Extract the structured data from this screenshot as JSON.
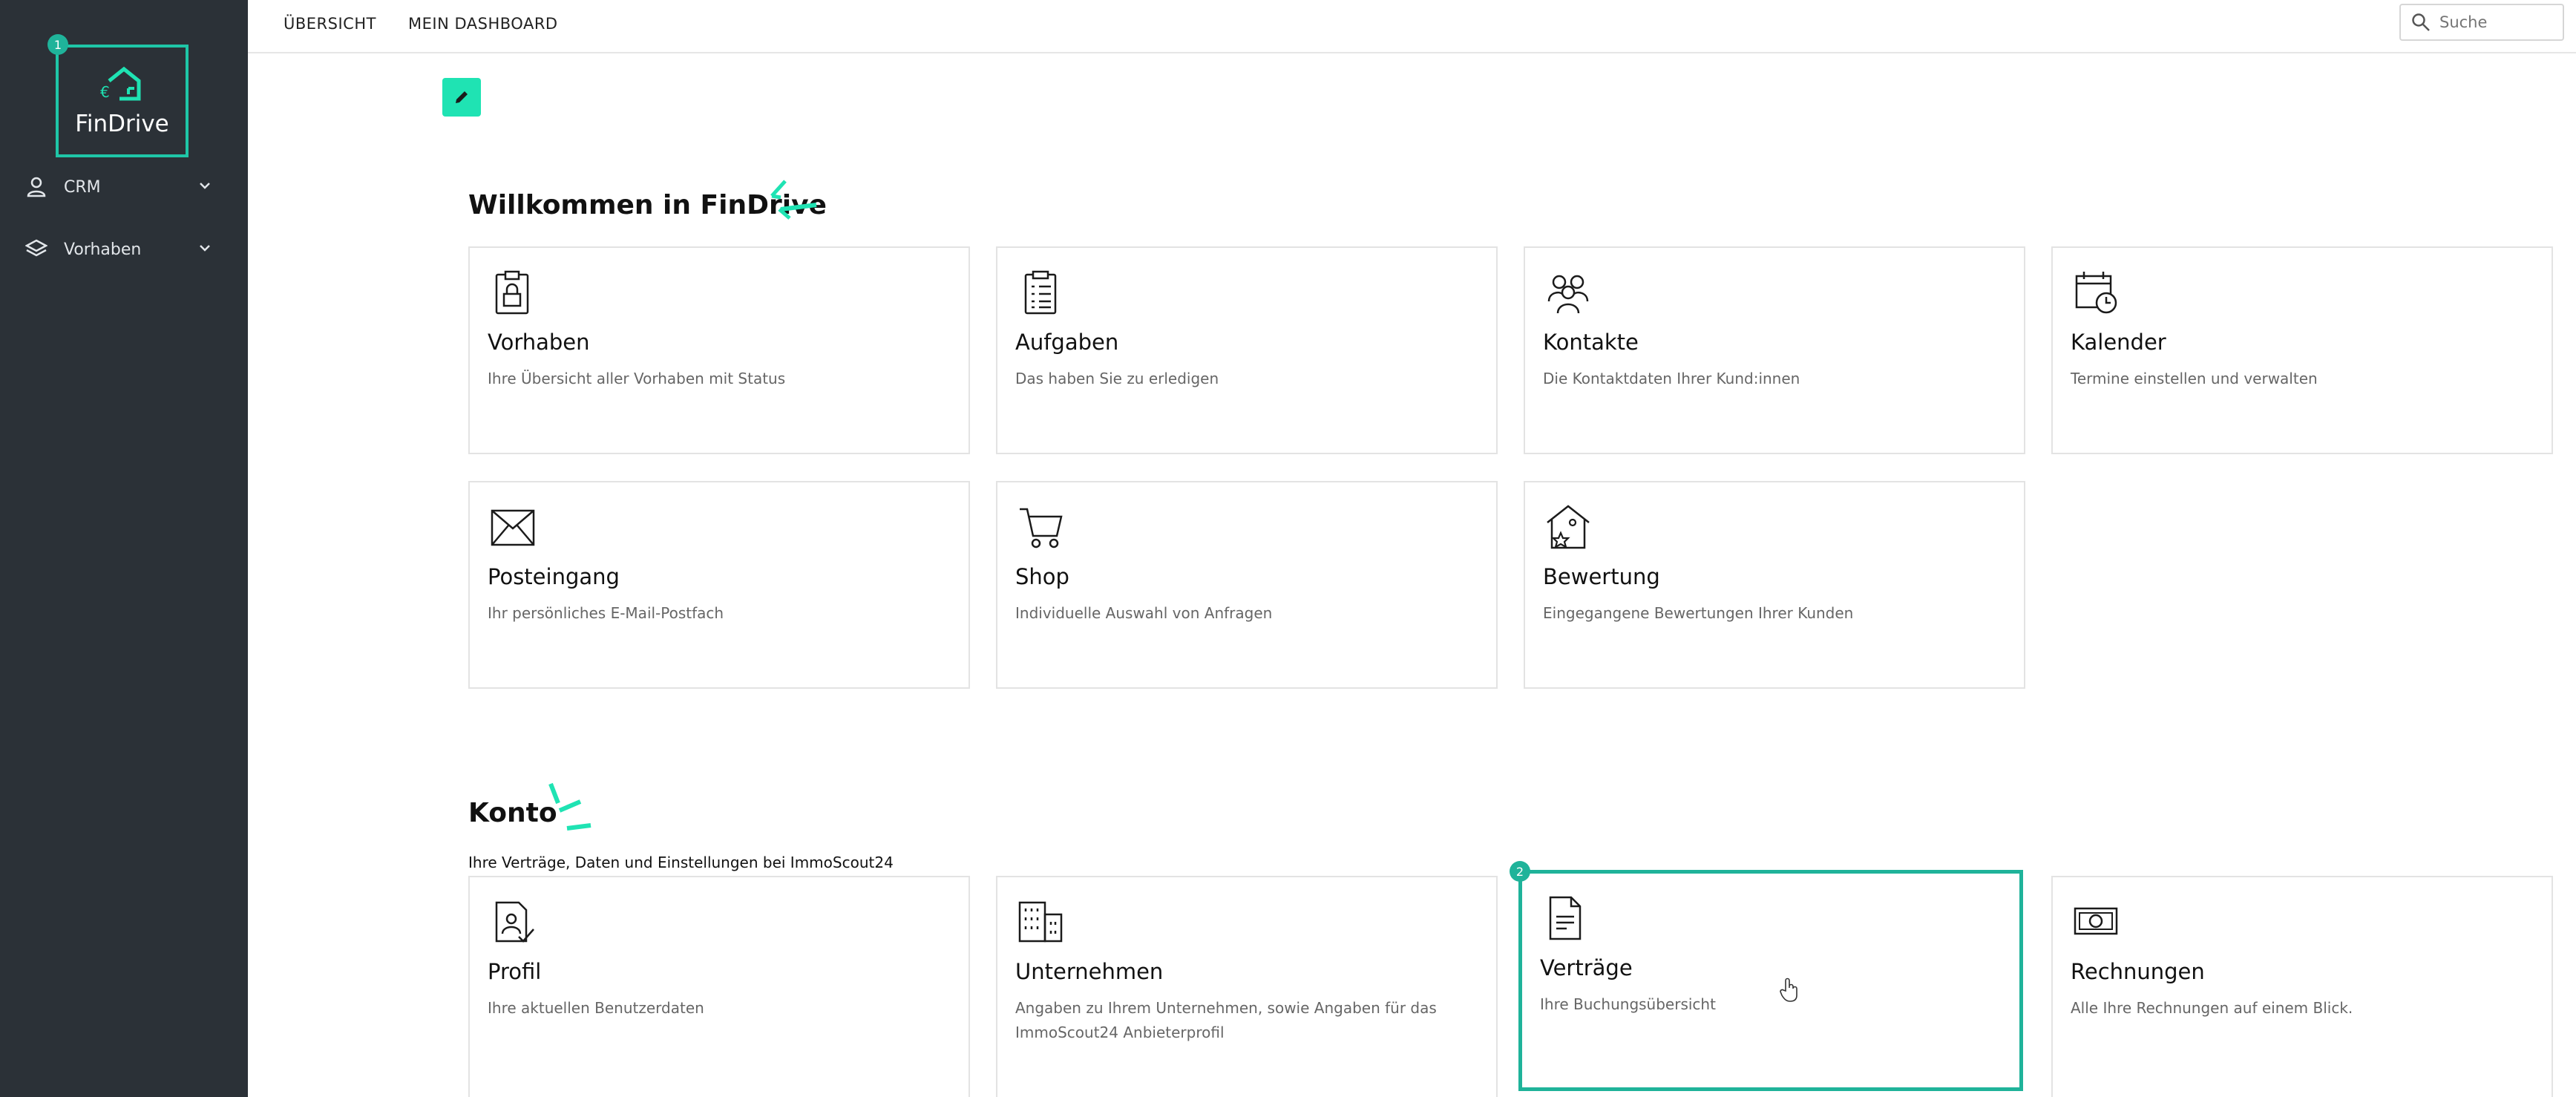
{
  "app": {
    "name": "FinDrive"
  },
  "steps": {
    "first": "1",
    "second": "2"
  },
  "colors": {
    "sidebar": "#2b3137",
    "accent": "#1fe3b3",
    "highlight": "#1fb39a"
  },
  "sidebar": {
    "items": [
      {
        "label": "CRM",
        "icon": "person-icon"
      },
      {
        "label": "Vorhaben",
        "icon": "layers-icon"
      }
    ]
  },
  "topbar": {
    "tabs": [
      {
        "label": "ÜBERSICHT"
      },
      {
        "label": "MEIN DASHBOARD"
      }
    ],
    "search": {
      "placeholder": "Suche"
    }
  },
  "welcome": {
    "title": "Willkommen in FinDrive",
    "cards": [
      {
        "title": "Vorhaben",
        "desc": "Ihre Übersicht aller Vorhaben mit Status",
        "icon": "clipboard-lock-icon"
      },
      {
        "title": "Aufgaben",
        "desc": "Das haben Sie zu erledigen",
        "icon": "checklist-icon"
      },
      {
        "title": "Kontakte",
        "desc": "Die Kontaktdaten Ihrer Kund:innen",
        "icon": "people-icon"
      },
      {
        "title": "Kalender",
        "desc": "Termine einstellen und verwalten",
        "icon": "calendar-clock-icon"
      },
      {
        "title": "Posteingang",
        "desc": "Ihr persönliches E-Mail-Postfach",
        "icon": "envelope-icon"
      },
      {
        "title": "Shop",
        "desc": "Individuelle Auswahl von Anfragen",
        "icon": "cart-icon"
      },
      {
        "title": "Bewertung",
        "desc": "Eingegangene Bewertungen Ihrer Kunden",
        "icon": "house-star-icon"
      }
    ]
  },
  "konto": {
    "title": "Konto",
    "subtitle": "Ihre Verträge, Daten und Einstellungen bei ImmoScout24",
    "cards": [
      {
        "title": "Profil",
        "desc": "Ihre aktuellen Benutzerdaten",
        "icon": "profile-doc-icon"
      },
      {
        "title": "Unternehmen",
        "desc": "Angaben zu Ihrem Unternehmen, sowie Angaben für das ImmoScout24 Anbieterprofil",
        "icon": "building-icon"
      },
      {
        "title": "Verträge",
        "desc": "Ihre Buchungsübersicht",
        "icon": "document-icon"
      },
      {
        "title": "Rechnungen",
        "desc": "Alle Ihre Rechnungen auf einem Blick.",
        "icon": "banknote-icon"
      }
    ]
  }
}
